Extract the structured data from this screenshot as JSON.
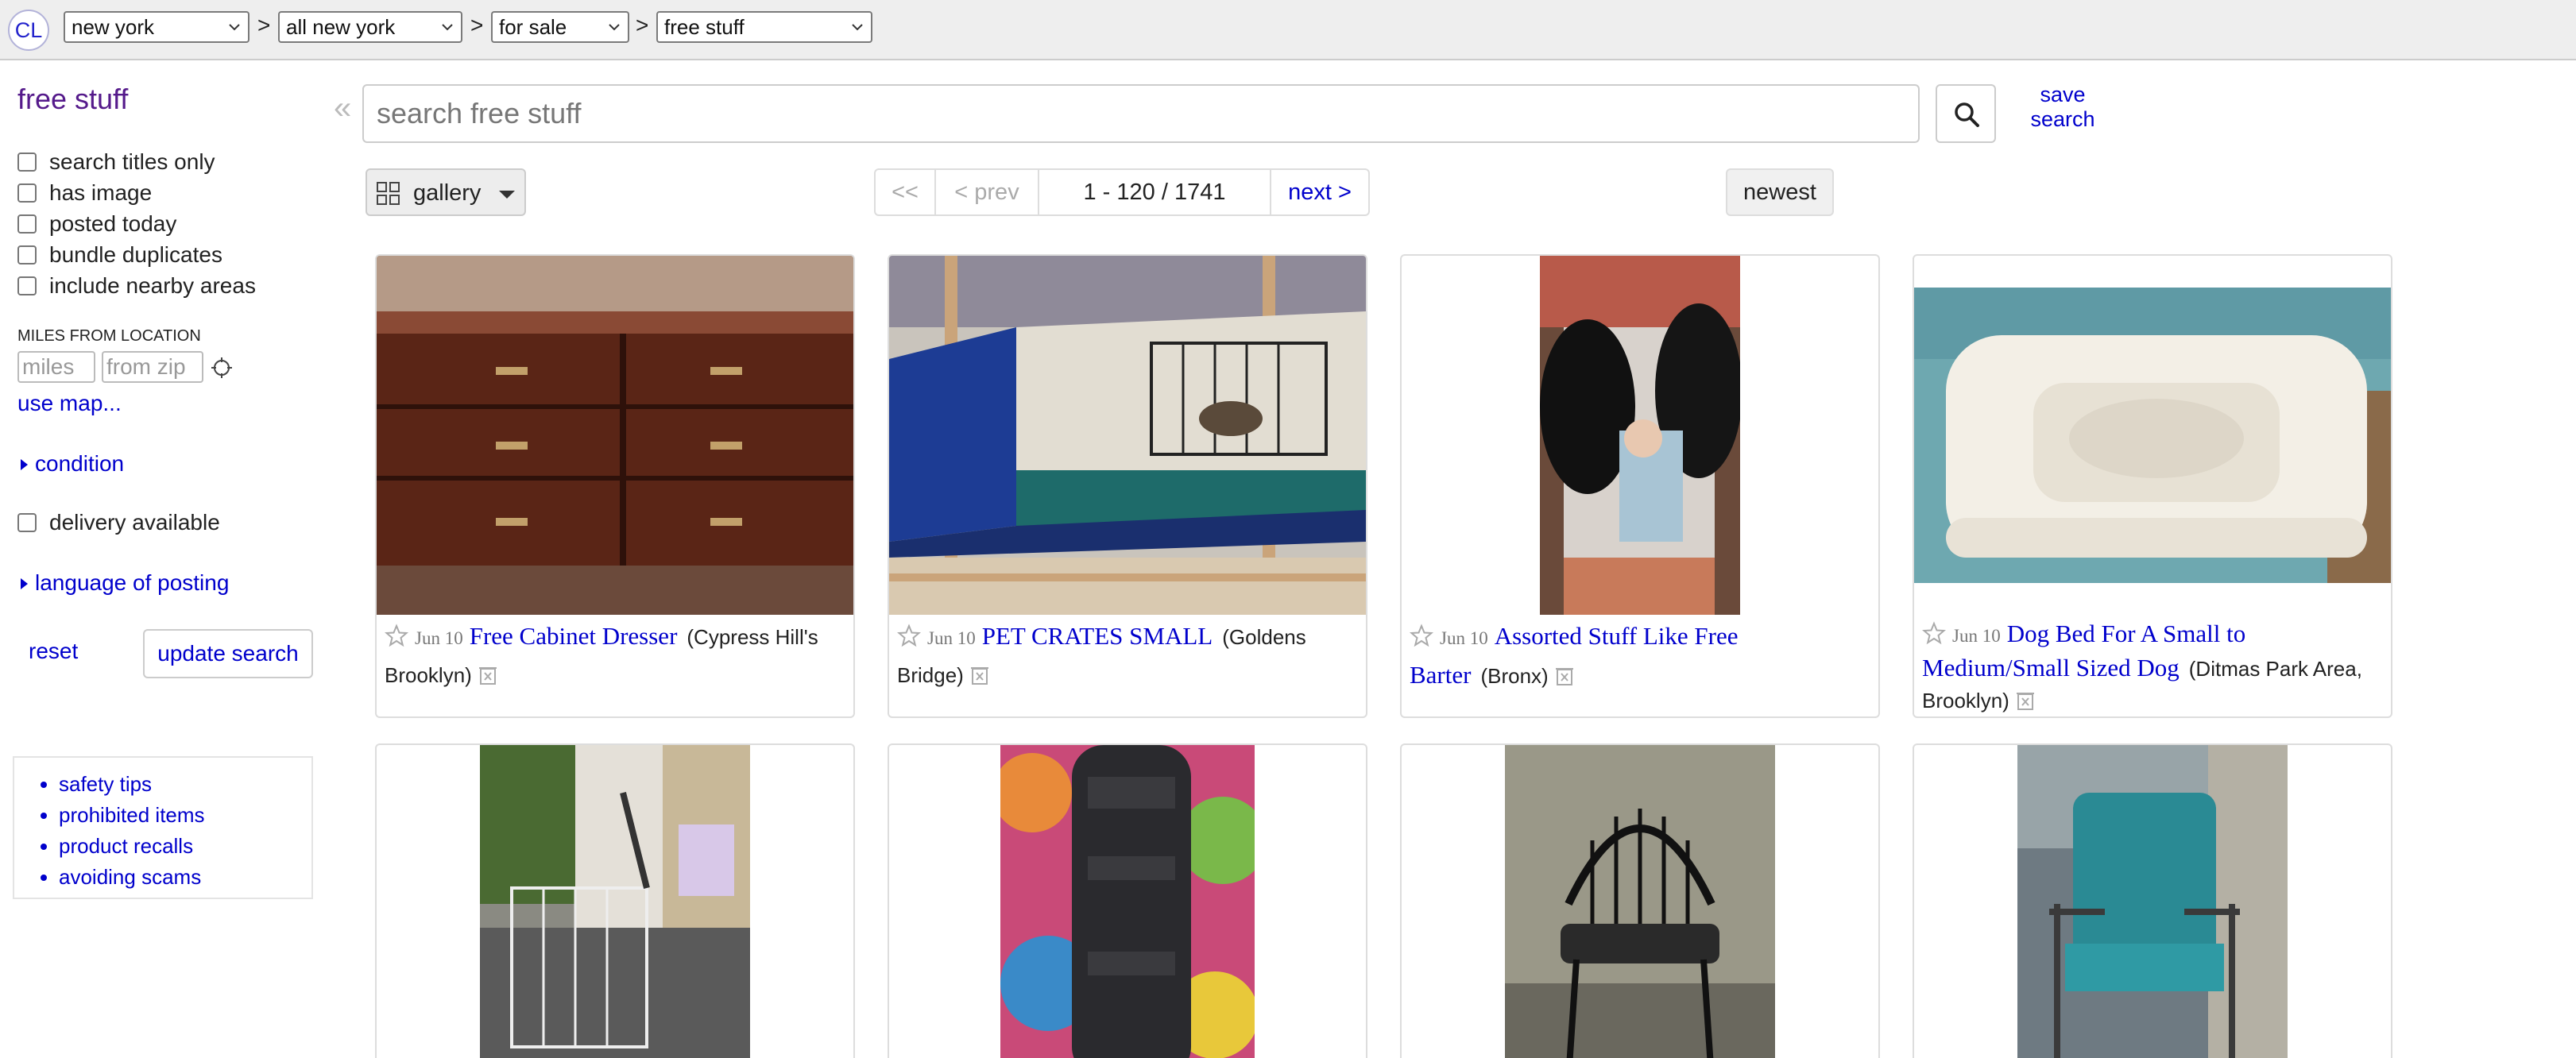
{
  "header": {
    "logo": "CL",
    "region": "new york",
    "subarea": "all new york",
    "section": "for sale",
    "category": "free stuff",
    "separator": ">"
  },
  "sidebar": {
    "title": "free stuff",
    "checkboxes": [
      {
        "label": "search titles only",
        "checked": false
      },
      {
        "label": "has image",
        "checked": false
      },
      {
        "label": "posted today",
        "checked": false
      },
      {
        "label": "bundle duplicates",
        "checked": false
      },
      {
        "label": "include nearby areas",
        "checked": false
      }
    ],
    "miles_label": "MILES FROM LOCATION",
    "miles_placeholder": "miles",
    "zip_placeholder": "from zip",
    "use_map": "use map...",
    "condition": "condition",
    "delivery": "delivery available",
    "language": "language of posting",
    "reset": "reset",
    "update": "update search",
    "links": [
      "safety tips",
      "prohibited items",
      "product recalls",
      "avoiding scams"
    ]
  },
  "search": {
    "placeholder": "search free stuff",
    "save_line1": "save",
    "save_line2": "search",
    "view_label": "gallery",
    "sort_label": "newest"
  },
  "pager": {
    "first": "<<",
    "prev": "< prev",
    "range": "1 - 120 / 1741",
    "next": "next >"
  },
  "listings": [
    {
      "date": "Jun 10",
      "title": "Free Cabinet Dresser",
      "hood": "(Cypress Hill's Brooklyn)"
    },
    {
      "date": "Jun 10",
      "title": "PET CRATES SMALL",
      "hood": "(Goldens Bridge)"
    },
    {
      "date": "Jun 10",
      "title": "Assorted Stuff Like Free Barter",
      "hood": "(Bronx)"
    },
    {
      "date": "Jun 10",
      "title": "Dog Bed For A Small to Medium/Small Sized Dog",
      "hood": "(Ditmas Park Area, Brooklyn)"
    }
  ],
  "colors": {
    "link": "#0000cc",
    "visited_title": "#551a8b",
    "topbar_bg": "#eeeeee",
    "border": "#cccccc"
  },
  "icons": [
    "search-icon",
    "gallery-grid-icon",
    "locate-icon",
    "star-icon",
    "trash-icon",
    "chevron-down-icon",
    "collapse-icon"
  ]
}
